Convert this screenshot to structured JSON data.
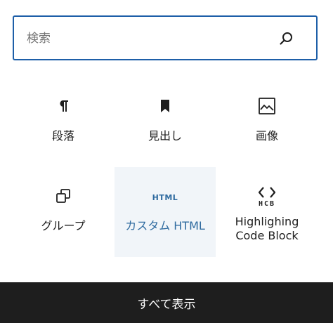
{
  "search": {
    "placeholder": "検索",
    "value": ""
  },
  "blocks": [
    {
      "label": "段落",
      "icon": "paragraph-icon"
    },
    {
      "label": "見出し",
      "icon": "bookmark-icon"
    },
    {
      "label": "画像",
      "icon": "image-icon"
    },
    {
      "label": "グループ",
      "icon": "group-icon"
    },
    {
      "label": "カスタム HTML",
      "icon": "html-icon",
      "icon_text": "HTML",
      "selected": true
    },
    {
      "label": "Highlighing\nCode Block",
      "icon": "hcb-icon",
      "icon_text": "HCB"
    }
  ],
  "footer": {
    "label": "すべて表示"
  },
  "colors": {
    "accent": "#1e5fa8",
    "selected_text": "#2f6ba0",
    "selected_bg": "#f1f5f9",
    "footer_bg": "#1e1e1e"
  }
}
